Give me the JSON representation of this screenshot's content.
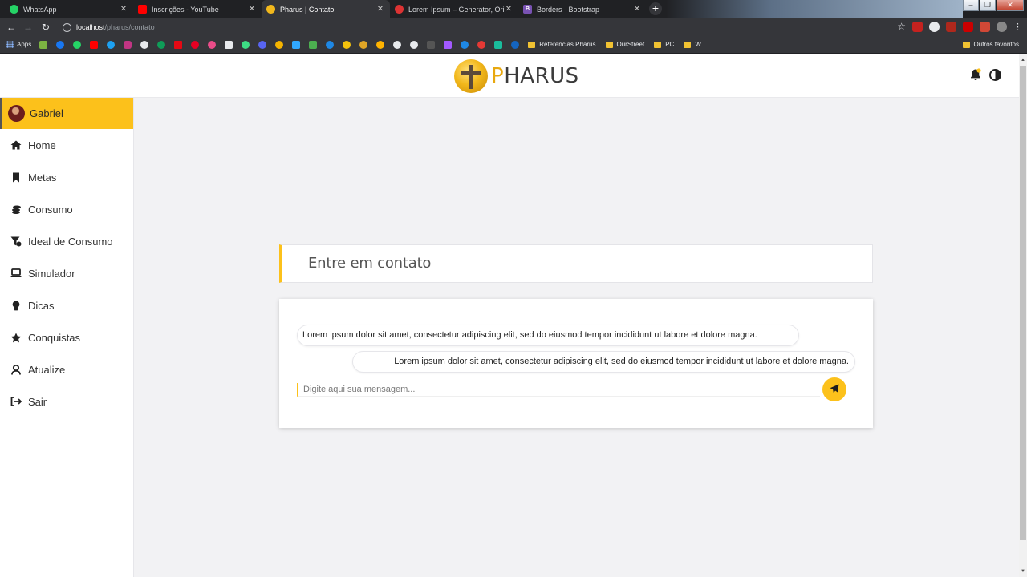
{
  "browser": {
    "tabs": [
      {
        "title": "WhatsApp",
        "active": false,
        "favicon_color": "#25d366"
      },
      {
        "title": "Inscrições - YouTube",
        "active": false,
        "favicon_color": "#ff0000"
      },
      {
        "title": "Pharus | Contato",
        "active": true,
        "favicon_color": "#f2b81c"
      },
      {
        "title": "Lorem Ipsum – Generator, Origin",
        "active": false,
        "favicon_color": "#d33"
      },
      {
        "title": "Borders · Bootstrap",
        "active": false,
        "favicon_color": "#7952b3"
      }
    ],
    "url_host": "localhost",
    "url_path": "/pharus/contato",
    "bookmarks": {
      "apps_label": "Apps",
      "folders": [
        "Referencias Pharus",
        "OurStreet",
        "PC",
        "W"
      ],
      "other_label": "Outros favoritos"
    }
  },
  "header": {
    "logo_initial": "P",
    "logo_rest": "HARUS"
  },
  "sidebar": {
    "profile_name": "Gabriel",
    "items": [
      {
        "label": "Home",
        "icon": "home-icon"
      },
      {
        "label": "Metas",
        "icon": "bookmark-icon"
      },
      {
        "label": "Consumo",
        "icon": "coins-icon"
      },
      {
        "label": "Ideal de Consumo",
        "icon": "filter-icon"
      },
      {
        "label": "Simulador",
        "icon": "laptop-icon"
      },
      {
        "label": "Dicas",
        "icon": "lightbulb-icon"
      },
      {
        "label": "Conquistas",
        "icon": "star-icon"
      },
      {
        "label": "Atualize",
        "icon": "user-icon"
      },
      {
        "label": "Sair",
        "icon": "sign-out-icon"
      }
    ]
  },
  "contact": {
    "title": "Entre em contato",
    "messages": [
      {
        "text": "Lorem ipsum dolor sit amet, consectetur adipiscing elit, sed do eiusmod tempor incididunt ut labore et dolore magna.",
        "direction": "received"
      },
      {
        "text": "Lorem ipsum dolor sit amet, consectetur adipiscing elit, sed do eiusmod tempor incididunt ut labore et dolore magna.",
        "direction": "sent"
      }
    ],
    "input_placeholder": "Digite aqui sua mensagem...",
    "accent_color": "#fcc11b"
  }
}
